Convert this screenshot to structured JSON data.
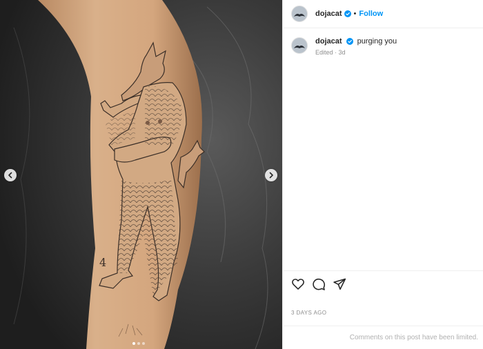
{
  "post": {
    "username": "dojacat",
    "separator": "•",
    "follow_label": "Follow",
    "caption_text": "purging you",
    "meta": "Edited · 3d",
    "timestamp": "3 DAYS AGO",
    "comments_notice": "Comments on this post have been limited.",
    "tattoo_number": "4"
  },
  "media": {
    "slide_count": 3,
    "active_slide": 1
  },
  "icons": {
    "verified": "verified-badge-icon",
    "like": "heart-icon",
    "comment": "comment-icon",
    "share": "share-icon",
    "prev": "chevron-left-icon",
    "next": "chevron-right-icon"
  },
  "colors": {
    "accent": "#0095f6",
    "muted": "#8e8e8e",
    "text": "#262626"
  }
}
